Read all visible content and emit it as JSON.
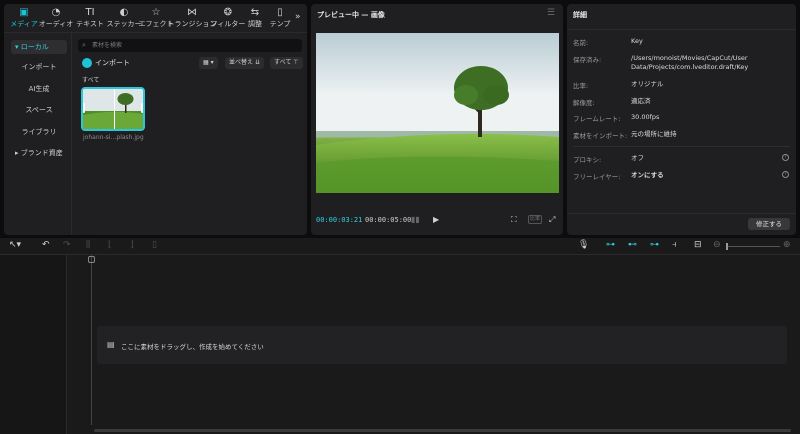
{
  "media_tabs": [
    {
      "label": "メディア",
      "icon": "media-icon",
      "glyph": "▣"
    },
    {
      "label": "オーディオ",
      "icon": "audio-icon",
      "glyph": "◔"
    },
    {
      "label": "テキスト",
      "icon": "text-icon",
      "glyph": "TI"
    },
    {
      "label": "ステッカー",
      "icon": "sticker-icon",
      "glyph": "◐"
    },
    {
      "label": "エフェクト",
      "icon": "effect-icon",
      "glyph": "☆"
    },
    {
      "label": "トランジション",
      "icon": "transition-icon",
      "glyph": "⋈"
    },
    {
      "label": "フィルター",
      "icon": "filter-icon",
      "glyph": "❂"
    },
    {
      "label": "調整",
      "icon": "adjust-icon",
      "glyph": "⇆"
    },
    {
      "label": "テンプ",
      "icon": "template-icon",
      "glyph": "▯"
    }
  ],
  "more_tabs_glyph": "»",
  "sidebar": {
    "local": "▾ ローカル",
    "import": "インポート",
    "ai": "AI生成",
    "space": "スペース",
    "library": "ライブラリ",
    "brand": "▸ ブランド資産"
  },
  "media": {
    "search_placeholder": "素材を検索",
    "import_label": "インポート",
    "sort_label": "並べ替え",
    "filter_label": "すべて",
    "section_label": "すべて",
    "file_name": "johann-si…plash.jpg"
  },
  "preview": {
    "title": "プレビュー中 — 画像",
    "current_time": "00:00:03:21",
    "duration": "00:00:05:00",
    "ratio_label": "比率"
  },
  "details": {
    "title": "詳細",
    "rows": [
      {
        "label": "名前:",
        "value": "Key"
      },
      {
        "label": "保存済み:",
        "value": "/Users/monoist/Movies/CapCut/User Data/Projects/com.lveditor.draft/Key"
      },
      {
        "label": "比率:",
        "value": "オリジナル"
      },
      {
        "label": "解像度:",
        "value": "適応済"
      },
      {
        "label": "フレームレート:",
        "value": "30.00fps"
      },
      {
        "label": "素材をインポート:",
        "value": "元の場所に維持"
      }
    ],
    "proxy_label": "プロキシ:",
    "proxy_value": "オフ",
    "free_layer_label": "フリーレイヤー:",
    "free_layer_value": "オンにする",
    "fix_button": "修正する"
  },
  "timeline": {
    "drop_hint": "ここに素材をドラッグし、作成を始めてください"
  },
  "colors": {
    "accent": "#1fc3d6",
    "panel": "#1f1f21",
    "background": "#0c0c0d"
  }
}
